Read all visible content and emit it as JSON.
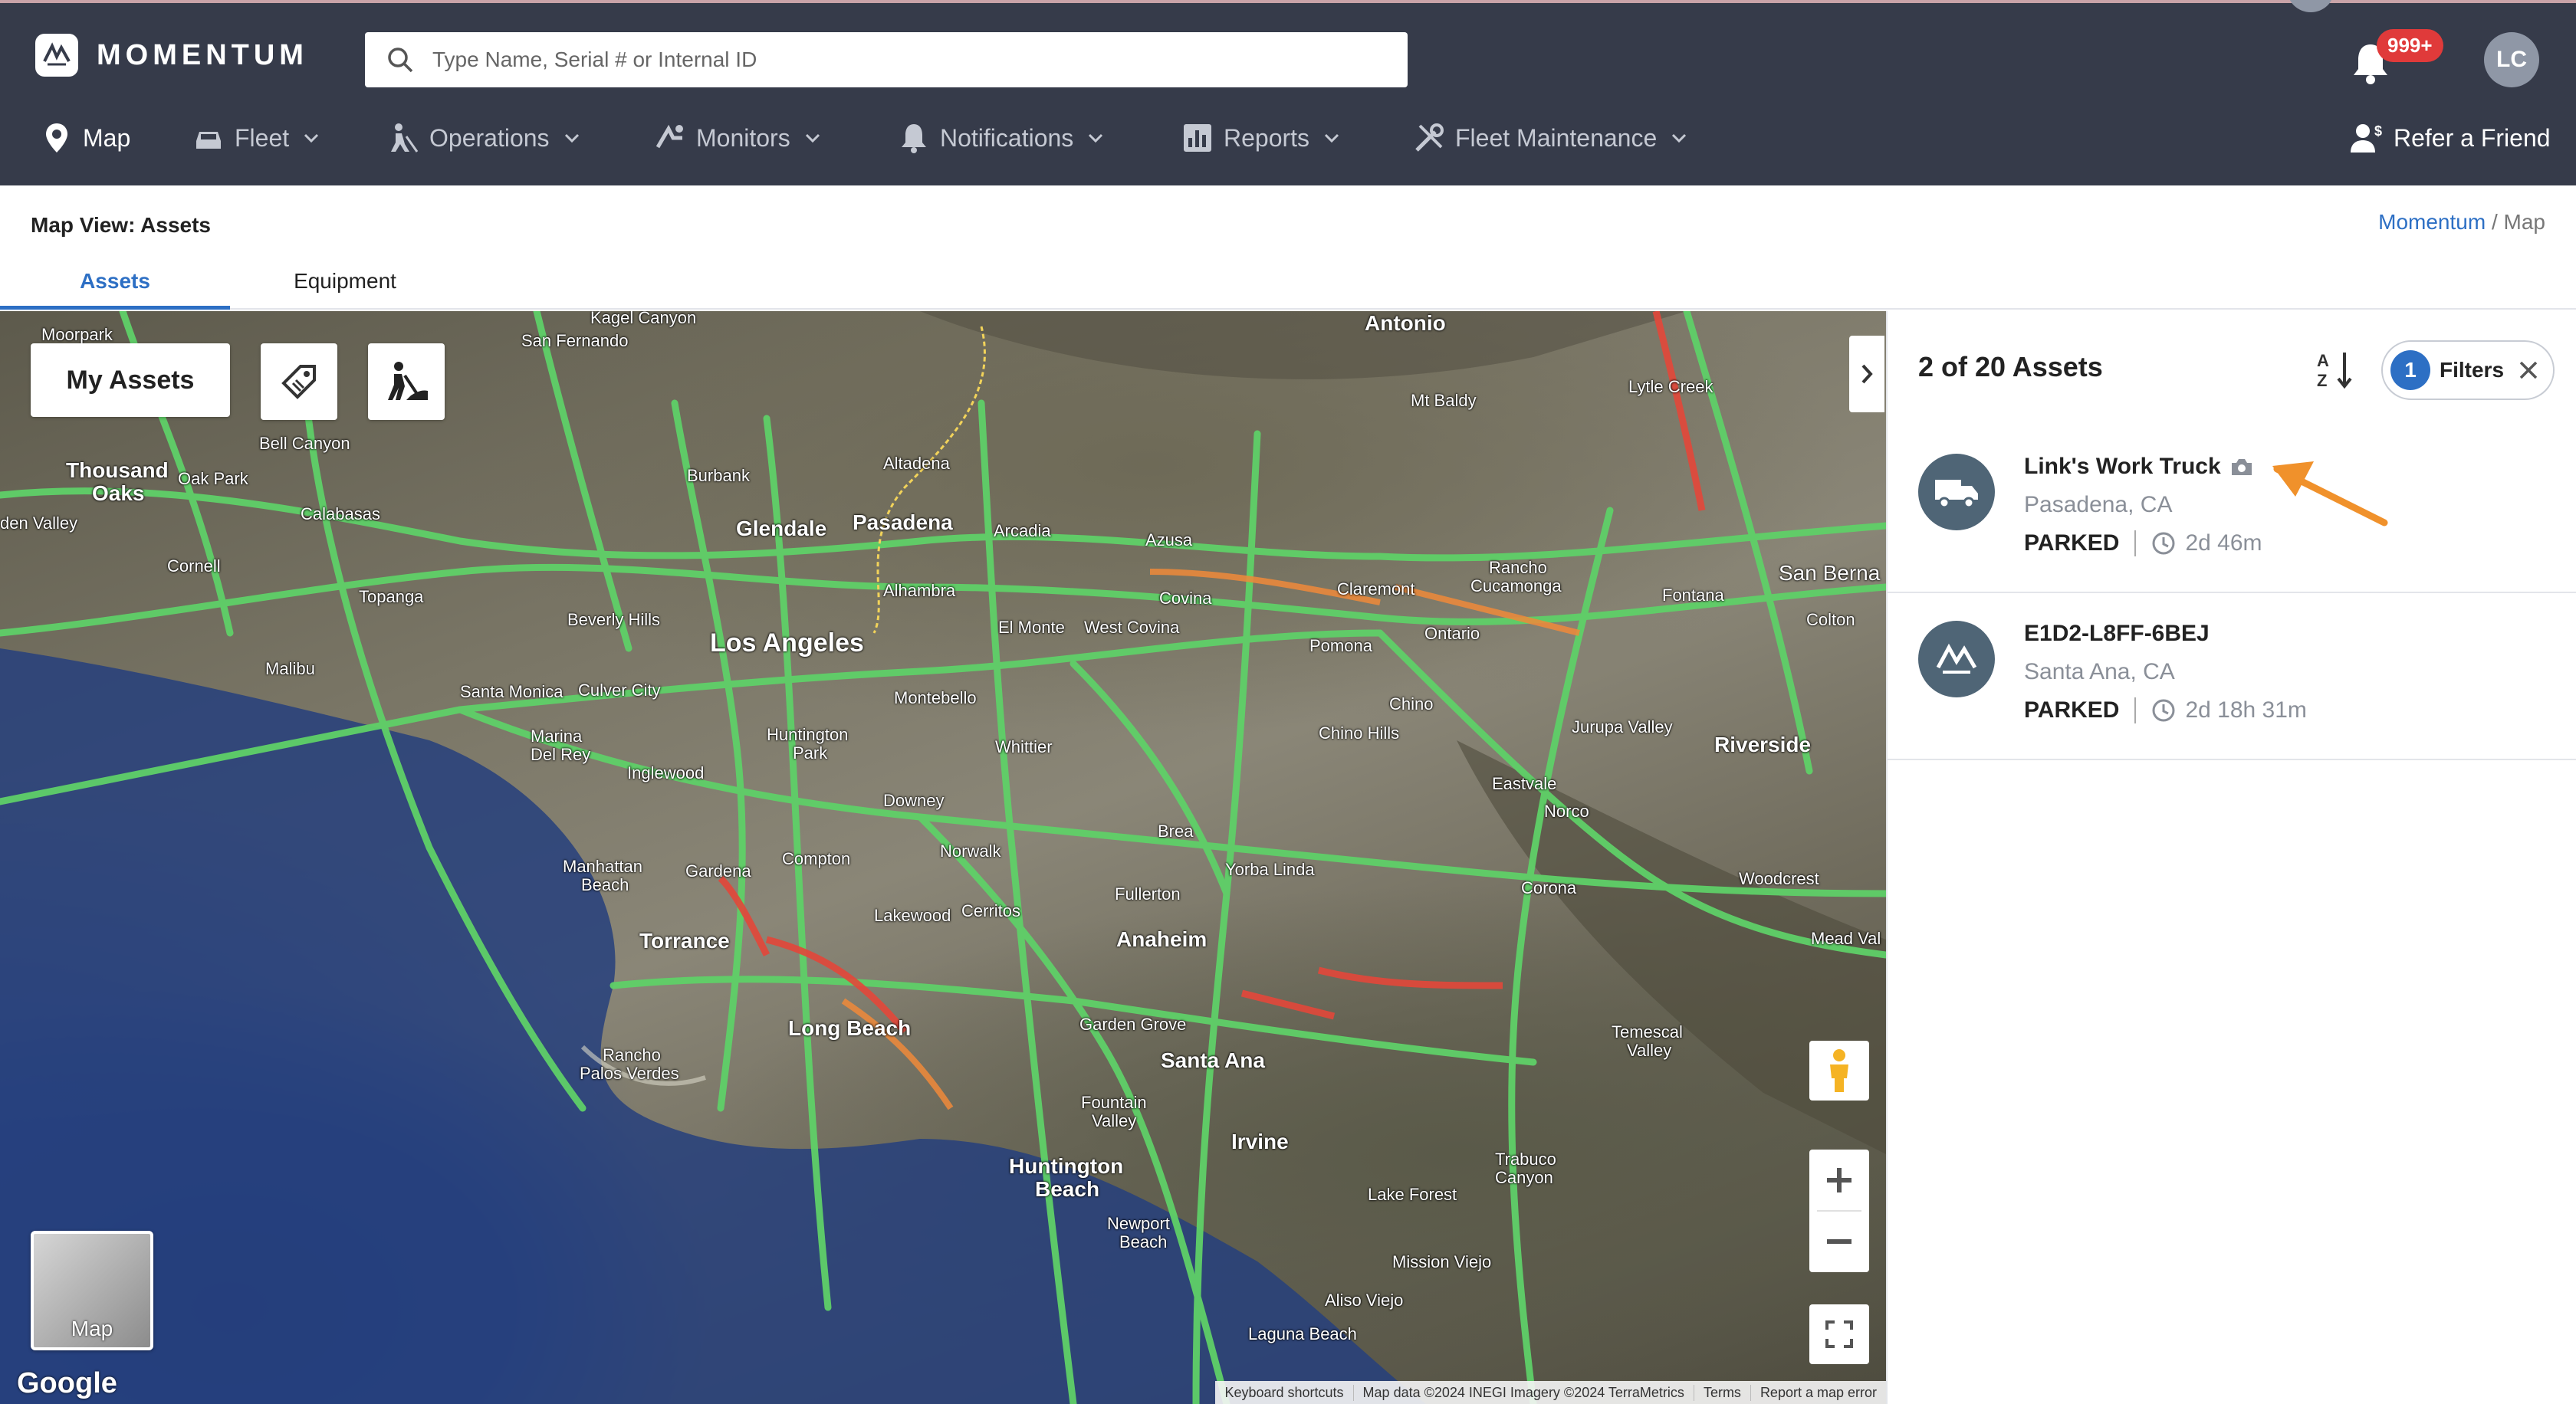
{
  "app": {
    "brand": "MOMENTUM"
  },
  "search": {
    "placeholder": "Type Name, Serial # or Internal ID",
    "value": ""
  },
  "header": {
    "notifications_badge": "999+",
    "user_initials": "LC",
    "refer_label": "Refer a Friend"
  },
  "nav": {
    "items": [
      {
        "label": "Map",
        "icon": "map-pin-icon"
      },
      {
        "label": "Fleet",
        "icon": "car-icon"
      },
      {
        "label": "Operations",
        "icon": "worker-icon"
      },
      {
        "label": "Monitors",
        "icon": "monitors-icon"
      },
      {
        "label": "Notifications",
        "icon": "bell-icon"
      },
      {
        "label": "Reports",
        "icon": "chart-icon"
      },
      {
        "label": "Fleet Maintenance",
        "icon": "tools-icon"
      }
    ]
  },
  "page": {
    "title": "Map View: Assets",
    "breadcrumb": {
      "root": "Momentum",
      "sep": " / ",
      "current": "Map"
    },
    "tabs": [
      {
        "label": "Assets"
      },
      {
        "label": "Equipment"
      }
    ]
  },
  "map": {
    "my_assets_label": "My Assets",
    "map_type_label": "Map",
    "google_label": "Google",
    "attribution": [
      "Keyboard shortcuts",
      "Map data ©2024 INEGI Imagery ©2024 TerraMetrics",
      "Terms",
      "Report a map error"
    ],
    "labels": {
      "kagel": "Kagel Canyon",
      "moorpark": "Moorpark",
      "sanfernando": "San Fernando",
      "antonio": "Antonio",
      "mtbaldy": "Mt Baldy",
      "lytle": "Lytle Creek",
      "bellcanyon": "Bell Canyon",
      "thousand": "Thousand",
      "oaks": "Oaks",
      "oakpark": "Oak Park",
      "calabasas": "Calabasas",
      "hidden": "den Valley",
      "burbank": "Burbank",
      "altadena": "Altadena",
      "glendale": "Glendale",
      "pasadena": "Pasadena",
      "arcadia": "Arcadia",
      "azusa": "Azusa",
      "rancho": "Rancho",
      "cucamonga": "Cucamonga",
      "sanberna": "San Berna",
      "cornell": "Cornell",
      "topanga": "Topanga",
      "beverly": "Beverly Hills",
      "losangeles": "Los Angeles",
      "alhambra": "Alhambra",
      "elmonte": "El Monte",
      "westcovina": "West Covina",
      "covina": "Covina",
      "claremont": "Claremont",
      "ontario": "Ontario",
      "fontana": "Fontana",
      "colton": "Colton",
      "malibu": "Malibu",
      "santamonica": "Santa Monica",
      "culver": "Culver City",
      "montebello": "Montebello",
      "pomona": "Pomona",
      "chino": "Chino",
      "chinohills": "Chino Hills",
      "jurupa": "Jurupa Valley",
      "riverside": "Riverside",
      "marina": "Marina",
      "delrey": "Del Rey",
      "huntington": "Huntington",
      "park": "Park",
      "whittier": "Whittier",
      "inglewood": "Inglewood",
      "downey": "Downey",
      "eastvale": "Eastvale",
      "norco": "Norco",
      "manhattan": "Manhattan",
      "beach": "Beach",
      "gardena": "Gardena",
      "compton": "Compton",
      "norwalk": "Norwalk",
      "brea": "Brea",
      "yorba": "Yorba Linda",
      "fullerton": "Fullerton",
      "corona": "Corona",
      "woodcrest": "Woodcrest",
      "torrance": "Torrance",
      "lakewood": "Lakewood",
      "cerritos": "Cerritos",
      "anaheim": "Anaheim",
      "meadval": "Mead Val",
      "longbeach": "Long Beach",
      "rancho2": "Rancho",
      "palos": "Palos Verdes",
      "gardengrove": "Garden Grove",
      "santaana": "Santa Ana",
      "temescal": "Temescal",
      "valley": "Valley",
      "fountain": "Fountain",
      "valley2": "Valley",
      "irvine": "Irvine",
      "trabuco": "Trabuco",
      "canyon": "Canyon",
      "hbeach": "Huntington",
      "beach2": "Beach",
      "newport": "Newport",
      "beach3": "Beach",
      "lakeforest": "Lake Forest",
      "missionviejo": "Mission Viejo",
      "aliso": "Aliso Viejo",
      "laguna": "Laguna Beach"
    }
  },
  "panel": {
    "count_label": "2 of 20 Assets",
    "filters_count": "1",
    "filters_label": "Filters",
    "assets": [
      {
        "name": "Link's Work Truck",
        "location": "Pasadena, CA",
        "status": "PARKED",
        "duration": "2d 46m",
        "icon": "truck-icon",
        "has_photo": true
      },
      {
        "name": "E1D2-L8FF-6BEJ",
        "location": "Santa Ana, CA",
        "status": "PARKED",
        "duration": "2d 18h 31m",
        "icon": "momentum-logo-icon",
        "has_photo": false
      }
    ]
  },
  "colors": {
    "header_bg": "#363b4a",
    "accent": "#2d6fc4",
    "badge": "#e03a3a",
    "arrow": "#f0912b",
    "road_green": "#5fd068"
  }
}
